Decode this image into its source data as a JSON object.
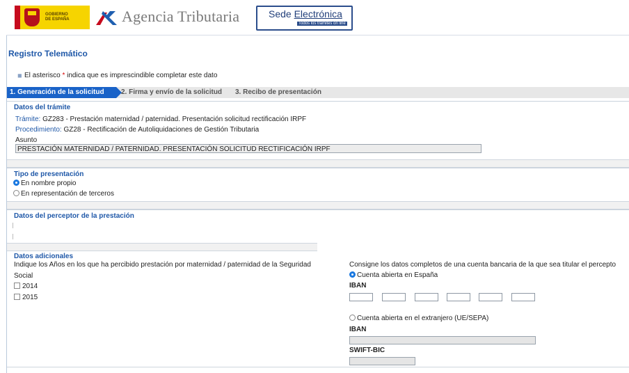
{
  "header": {
    "gob_line1": "GOBIERNO",
    "gob_line2": "DE ESPAÑA",
    "agency_title": "Agencia Tributaria",
    "sede_title_part1": "Sede ",
    "sede_title_part2": "Electrónica",
    "sede_subtitle": "Todos los trámites on line"
  },
  "page": {
    "title": "Registro Telemático",
    "note_prefix": "El asterisco ",
    "note_star": "*",
    "note_suffix": " indica que es imprescindible completar este dato"
  },
  "steps": [
    {
      "label": "1. Generación de la solicitud",
      "active": true
    },
    {
      "label": "2. Firma y envío de la solicitud",
      "active": false
    },
    {
      "label": "3. Recibo de presentación",
      "active": false
    }
  ],
  "tramite": {
    "heading": "Datos del trámite",
    "tramite_label": "Trámite:",
    "tramite_value": " GZ283 - Prestación maternidad / paternidad. Presentación solicitud rectificación IRPF",
    "procedimiento_label": "Procedimiento:",
    "procedimiento_value": " GZ28 - Rectificación de Autoliquidaciones de Gestión Tributaria",
    "asunto_label": "Asunto",
    "asunto_value": "PRESTACIÓN MATERNIDAD / PATERNIDAD. PRESENTACIÓN SOLICITUD RECTIFICACIÓN IRPF"
  },
  "presentacion": {
    "heading": "Tipo de presentación",
    "option1": "En nombre propio",
    "option2": "En representación de terceros",
    "selected": "En nombre propio"
  },
  "perceptor": {
    "heading": "Datos del perceptor de la prestación"
  },
  "adicionales": {
    "heading": "Datos adicionales",
    "years_text_line1": "Indique los Años en los que ha percibido prestación por maternidad / paternidad de la Seguridad",
    "years_text_line2": "Social",
    "year1": "2014",
    "year2": "2015",
    "bank_text": "Consigne los datos completos de una cuenta bancaria de la que sea titular el percepto",
    "option_spain": "Cuenta abierta en España",
    "iban_label": "IBAN",
    "option_foreign": "Cuenta abierta en el extranjero (UE/SEPA)",
    "iban_label2": "IBAN",
    "swift_label": "SWIFT-BIC"
  },
  "colors": {
    "accent": "#1a63c8",
    "heading_blue": "#1f58a8",
    "brand_yellow": "#f6d400",
    "brand_red": "#c60b1e"
  }
}
